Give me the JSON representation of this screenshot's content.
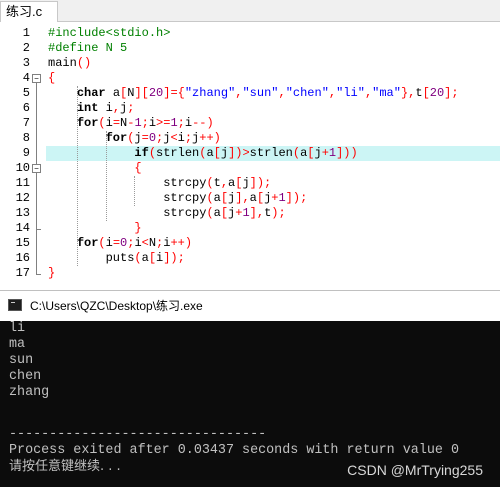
{
  "editor": {
    "tab_title": "练习.c",
    "line_numbers": [
      "1",
      "2",
      "3",
      "4",
      "5",
      "6",
      "7",
      "8",
      "9",
      "10",
      "11",
      "12",
      "13",
      "14",
      "15",
      "16",
      "17"
    ],
    "highlighted_line": 9,
    "fold_markers": {
      "open": "−"
    },
    "lines": [
      [
        {
          "t": "#include<stdio.h>",
          "c": "pp"
        }
      ],
      [
        {
          "t": "#define N 5",
          "c": "pp"
        }
      ],
      [
        {
          "t": "main",
          "c": "id"
        },
        {
          "t": "()",
          "c": "op"
        }
      ],
      [
        {
          "t": "{",
          "c": "op"
        }
      ],
      [
        {
          "t": "    ",
          "c": "id"
        },
        {
          "t": "char",
          "c": "kw"
        },
        {
          "t": " a",
          "c": "id"
        },
        {
          "t": "[",
          "c": "op"
        },
        {
          "t": "N",
          "c": "id"
        },
        {
          "t": "][",
          "c": "op"
        },
        {
          "t": "20",
          "c": "num"
        },
        {
          "t": "]={",
          "c": "op"
        },
        {
          "t": "\"zhang\"",
          "c": "str"
        },
        {
          "t": ",",
          "c": "op"
        },
        {
          "t": "\"sun\"",
          "c": "str"
        },
        {
          "t": ",",
          "c": "op"
        },
        {
          "t": "\"chen\"",
          "c": "str"
        },
        {
          "t": ",",
          "c": "op"
        },
        {
          "t": "\"li\"",
          "c": "str"
        },
        {
          "t": ",",
          "c": "op"
        },
        {
          "t": "\"ma\"",
          "c": "str"
        },
        {
          "t": "},",
          "c": "op"
        },
        {
          "t": "t",
          "c": "id"
        },
        {
          "t": "[",
          "c": "op"
        },
        {
          "t": "20",
          "c": "num"
        },
        {
          "t": "];",
          "c": "op"
        }
      ],
      [
        {
          "t": "    ",
          "c": "id"
        },
        {
          "t": "int",
          "c": "kw"
        },
        {
          "t": " i",
          "c": "id"
        },
        {
          "t": ",",
          "c": "op"
        },
        {
          "t": "j",
          "c": "id"
        },
        {
          "t": ";",
          "c": "op"
        }
      ],
      [
        {
          "t": "    ",
          "c": "id"
        },
        {
          "t": "for",
          "c": "kw"
        },
        {
          "t": "(",
          "c": "op"
        },
        {
          "t": "i",
          "c": "id"
        },
        {
          "t": "=",
          "c": "op"
        },
        {
          "t": "N",
          "c": "id"
        },
        {
          "t": "-",
          "c": "op"
        },
        {
          "t": "1",
          "c": "num"
        },
        {
          "t": ";",
          "c": "op"
        },
        {
          "t": "i",
          "c": "id"
        },
        {
          "t": ">=",
          "c": "op"
        },
        {
          "t": "1",
          "c": "num"
        },
        {
          "t": ";",
          "c": "op"
        },
        {
          "t": "i",
          "c": "id"
        },
        {
          "t": "--)",
          "c": "op"
        }
      ],
      [
        {
          "t": "        ",
          "c": "id"
        },
        {
          "t": "for",
          "c": "kw"
        },
        {
          "t": "(",
          "c": "op"
        },
        {
          "t": "j",
          "c": "id"
        },
        {
          "t": "=",
          "c": "op"
        },
        {
          "t": "0",
          "c": "num"
        },
        {
          "t": ";",
          "c": "op"
        },
        {
          "t": "j",
          "c": "id"
        },
        {
          "t": "<",
          "c": "op"
        },
        {
          "t": "i",
          "c": "id"
        },
        {
          "t": ";",
          "c": "op"
        },
        {
          "t": "j",
          "c": "id"
        },
        {
          "t": "++)",
          "c": "op"
        }
      ],
      [
        {
          "t": "            ",
          "c": "id"
        },
        {
          "t": "if",
          "c": "kw"
        },
        {
          "t": "(",
          "c": "op"
        },
        {
          "t": "strlen",
          "c": "id"
        },
        {
          "t": "(",
          "c": "op"
        },
        {
          "t": "a",
          "c": "id"
        },
        {
          "t": "[",
          "c": "op"
        },
        {
          "t": "j",
          "c": "id"
        },
        {
          "t": "])>",
          "c": "op"
        },
        {
          "t": "strlen",
          "c": "id"
        },
        {
          "t": "(",
          "c": "op"
        },
        {
          "t": "a",
          "c": "id"
        },
        {
          "t": "[",
          "c": "op"
        },
        {
          "t": "j",
          "c": "id"
        },
        {
          "t": "+",
          "c": "op"
        },
        {
          "t": "1",
          "c": "num"
        },
        {
          "t": "]))",
          "c": "op"
        }
      ],
      [
        {
          "t": "            ",
          "c": "id"
        },
        {
          "t": "{",
          "c": "op"
        }
      ],
      [
        {
          "t": "                ",
          "c": "id"
        },
        {
          "t": "strcpy",
          "c": "id"
        },
        {
          "t": "(",
          "c": "op"
        },
        {
          "t": "t",
          "c": "id"
        },
        {
          "t": ",",
          "c": "op"
        },
        {
          "t": "a",
          "c": "id"
        },
        {
          "t": "[",
          "c": "op"
        },
        {
          "t": "j",
          "c": "id"
        },
        {
          "t": "]);",
          "c": "op"
        }
      ],
      [
        {
          "t": "                ",
          "c": "id"
        },
        {
          "t": "strcpy",
          "c": "id"
        },
        {
          "t": "(",
          "c": "op"
        },
        {
          "t": "a",
          "c": "id"
        },
        {
          "t": "[",
          "c": "op"
        },
        {
          "t": "j",
          "c": "id"
        },
        {
          "t": "],",
          "c": "op"
        },
        {
          "t": "a",
          "c": "id"
        },
        {
          "t": "[",
          "c": "op"
        },
        {
          "t": "j",
          "c": "id"
        },
        {
          "t": "+",
          "c": "op"
        },
        {
          "t": "1",
          "c": "num"
        },
        {
          "t": "]);",
          "c": "op"
        }
      ],
      [
        {
          "t": "                ",
          "c": "id"
        },
        {
          "t": "strcpy",
          "c": "id"
        },
        {
          "t": "(",
          "c": "op"
        },
        {
          "t": "a",
          "c": "id"
        },
        {
          "t": "[",
          "c": "op"
        },
        {
          "t": "j",
          "c": "id"
        },
        {
          "t": "+",
          "c": "op"
        },
        {
          "t": "1",
          "c": "num"
        },
        {
          "t": "],",
          "c": "op"
        },
        {
          "t": "t",
          "c": "id"
        },
        {
          "t": ");",
          "c": "op"
        }
      ],
      [
        {
          "t": "            ",
          "c": "id"
        },
        {
          "t": "}",
          "c": "op"
        }
      ],
      [
        {
          "t": "    ",
          "c": "id"
        },
        {
          "t": "for",
          "c": "kw"
        },
        {
          "t": "(",
          "c": "op"
        },
        {
          "t": "i",
          "c": "id"
        },
        {
          "t": "=",
          "c": "op"
        },
        {
          "t": "0",
          "c": "num"
        },
        {
          "t": ";",
          "c": "op"
        },
        {
          "t": "i",
          "c": "id"
        },
        {
          "t": "<",
          "c": "op"
        },
        {
          "t": "N",
          "c": "id"
        },
        {
          "t": ";",
          "c": "op"
        },
        {
          "t": "i",
          "c": "id"
        },
        {
          "t": "++)",
          "c": "op"
        }
      ],
      [
        {
          "t": "        ",
          "c": "id"
        },
        {
          "t": "puts",
          "c": "id"
        },
        {
          "t": "(",
          "c": "op"
        },
        {
          "t": "a",
          "c": "id"
        },
        {
          "t": "[",
          "c": "op"
        },
        {
          "t": "i",
          "c": "id"
        },
        {
          "t": "]);",
          "c": "op"
        }
      ],
      [
        {
          "t": "}",
          "c": "op"
        }
      ]
    ]
  },
  "console": {
    "title": "C:\\Users\\QZC\\Desktop\\练习.exe",
    "output": [
      "li",
      "ma",
      "sun",
      "chen",
      "zhang"
    ],
    "separator": "--------------------------------",
    "exit_message": "Process exited after 0.03437 seconds with return value 0",
    "prompt": "请按任意键继续. . ."
  },
  "watermark": "CSDN @MrTrying255",
  "colors": {
    "preprocessor": "#008000",
    "string": "#0000ff",
    "number": "#800080",
    "operator": "#ff0000",
    "highlight": "#ccf5f5",
    "console_bg": "#0c0c0c",
    "console_fg": "#c0c0c0"
  }
}
